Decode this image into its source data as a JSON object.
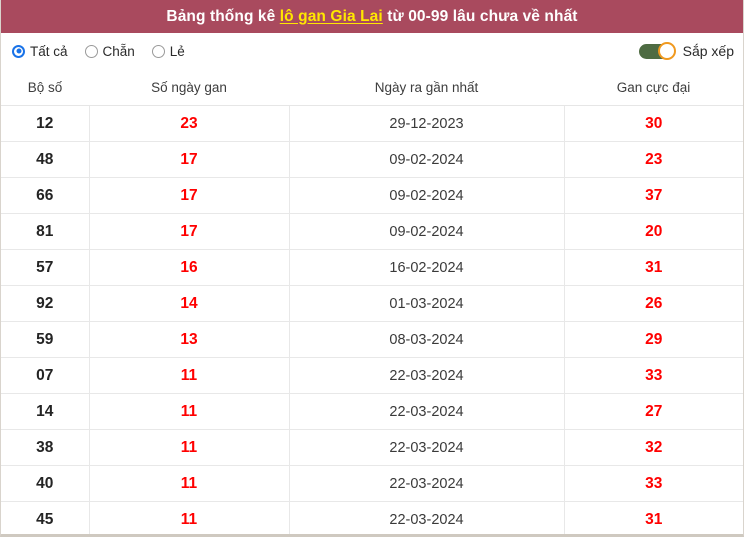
{
  "header": {
    "title_prefix": "Bảng thống kê ",
    "title_highlight": "lô gan Gia Lai",
    "title_suffix": " từ 00-99 lâu chưa về nhất",
    "background_color": "#a94a5e",
    "highlight_color": "#ffe700"
  },
  "filters": {
    "options": [
      {
        "label": "Tất cả",
        "selected": true
      },
      {
        "label": "Chẵn",
        "selected": false
      },
      {
        "label": "Lẻ",
        "selected": false
      }
    ],
    "sort": {
      "label": "Sắp xếp",
      "enabled": true,
      "track_color": "#4e6b42",
      "knob_color": "#f0991f"
    }
  },
  "table": {
    "columns": [
      "Bộ số",
      "Số ngày gan",
      "Ngày ra gần nhất",
      "Gan cực đại"
    ],
    "accent_color": "#ff0000",
    "rows": [
      {
        "bo_so": "12",
        "so_ngay_gan": "23",
        "ngay_ra": "29-12-2023",
        "gan_cuc_dai": "30"
      },
      {
        "bo_so": "48",
        "so_ngay_gan": "17",
        "ngay_ra": "09-02-2024",
        "gan_cuc_dai": "23"
      },
      {
        "bo_so": "66",
        "so_ngay_gan": "17",
        "ngay_ra": "09-02-2024",
        "gan_cuc_dai": "37"
      },
      {
        "bo_so": "81",
        "so_ngay_gan": "17",
        "ngay_ra": "09-02-2024",
        "gan_cuc_dai": "20"
      },
      {
        "bo_so": "57",
        "so_ngay_gan": "16",
        "ngay_ra": "16-02-2024",
        "gan_cuc_dai": "31"
      },
      {
        "bo_so": "92",
        "so_ngay_gan": "14",
        "ngay_ra": "01-03-2024",
        "gan_cuc_dai": "26"
      },
      {
        "bo_so": "59",
        "so_ngay_gan": "13",
        "ngay_ra": "08-03-2024",
        "gan_cuc_dai": "29"
      },
      {
        "bo_so": "07",
        "so_ngay_gan": "11",
        "ngay_ra": "22-03-2024",
        "gan_cuc_dai": "33"
      },
      {
        "bo_so": "14",
        "so_ngay_gan": "11",
        "ngay_ra": "22-03-2024",
        "gan_cuc_dai": "27"
      },
      {
        "bo_so": "38",
        "so_ngay_gan": "11",
        "ngay_ra": "22-03-2024",
        "gan_cuc_dai": "32"
      },
      {
        "bo_so": "40",
        "so_ngay_gan": "11",
        "ngay_ra": "22-03-2024",
        "gan_cuc_dai": "33"
      },
      {
        "bo_so": "45",
        "so_ngay_gan": "11",
        "ngay_ra": "22-03-2024",
        "gan_cuc_dai": "31"
      }
    ]
  }
}
